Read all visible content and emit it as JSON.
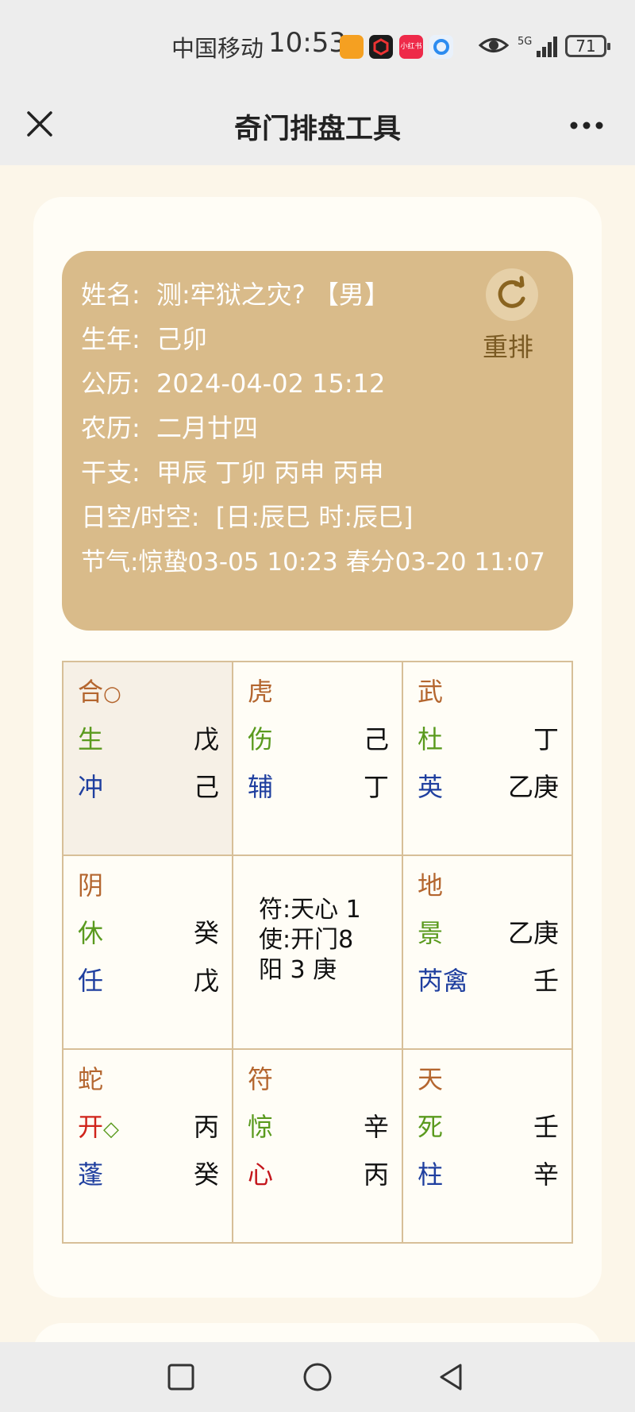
{
  "status_bar": {
    "carrier": "中国移动",
    "time": "10:53",
    "network": "5G",
    "battery": "71",
    "app_icons": [
      {
        "name": "orange-app-icon",
        "color": "#f5a021"
      },
      {
        "name": "black-app-icon",
        "color": "#1b1b1b"
      },
      {
        "name": "xiaohongshu-app-icon",
        "color": "#ee2a49",
        "label": "小红书"
      },
      {
        "name": "blue-app-icon",
        "color": "#2d8cf0"
      }
    ]
  },
  "title_bar": {
    "title": "奇门排盘工具"
  },
  "info": {
    "name_label": "姓名:",
    "name_value": "测:牢狱之灾? 【男】",
    "birth_year_label": "生年:",
    "birth_year_value": "己卯",
    "solar_label": "公历:",
    "solar_value": "2024-04-02 15:12",
    "lunar_label": "农历:",
    "lunar_value": "二月廿四",
    "ganzhi_label": "干支:",
    "ganzhi_value": "甲辰 丁卯 丙申 丙申",
    "void_label": "日空/时空:",
    "void_value": "[日:辰巳 时:辰巳]",
    "solar_terms": "节气:惊蛰03-05 10:23 春分03-20 11:07",
    "rearrange_label": "重排"
  },
  "grid": {
    "cells": [
      {
        "god": "合",
        "god_mark": "○",
        "door": "生",
        "door_mark": "",
        "heaven": "戊",
        "star": "冲",
        "earth": "己",
        "door_color": "#5a9a1e",
        "star_color": "#1f3f9f",
        "shaded": true
      },
      {
        "god": "虎",
        "god_mark": "",
        "door": "伤",
        "door_mark": "",
        "heaven": "己",
        "star": "辅",
        "earth": "丁",
        "door_color": "#5a9a1e",
        "star_color": "#1f3f9f",
        "shaded": false
      },
      {
        "god": "武",
        "god_mark": "",
        "door": "杜",
        "door_mark": "",
        "heaven": "丁",
        "star": "英",
        "earth": "乙庚",
        "door_color": "#5a9a1e",
        "star_color": "#1f3f9f",
        "shaded": false
      },
      {
        "god": "阴",
        "god_mark": "",
        "door": "休",
        "door_mark": "",
        "heaven": "癸",
        "star": "任",
        "earth": "戊",
        "door_color": "#5a9a1e",
        "star_color": "#1f3f9f",
        "shaded": false
      },
      {
        "center": true,
        "line1": "符:天心 1",
        "line2": "使:开门8",
        "line3": "阳 3 庚"
      },
      {
        "god": "地",
        "god_mark": "",
        "door": "景",
        "door_mark": "",
        "heaven": "乙庚",
        "star": "芮禽",
        "earth": "壬",
        "door_color": "#5a9a1e",
        "star_color": "#1f3f9f",
        "shaded": false
      },
      {
        "god": "蛇",
        "god_mark": "",
        "door": "开",
        "door_mark": "◇",
        "heaven": "丙",
        "star": "蓬",
        "earth": "癸",
        "door_color": "#d0241b",
        "star_color": "#1f3f9f",
        "shaded": false
      },
      {
        "god": "符",
        "god_mark": "",
        "door": "惊",
        "door_mark": "",
        "heaven": "辛",
        "star": "心",
        "earth": "丙",
        "door_color": "#5a9a1e",
        "star_color": "#c4161c",
        "shaded": false
      },
      {
        "god": "天",
        "god_mark": "",
        "door": "死",
        "door_mark": "",
        "heaven": "壬",
        "star": "柱",
        "earth": "辛",
        "door_color": "#5a9a1e",
        "star_color": "#1f3f9f",
        "shaded": false
      }
    ]
  },
  "nav_bar": {
    "buttons": [
      "recent-apps",
      "home",
      "back"
    ]
  }
}
